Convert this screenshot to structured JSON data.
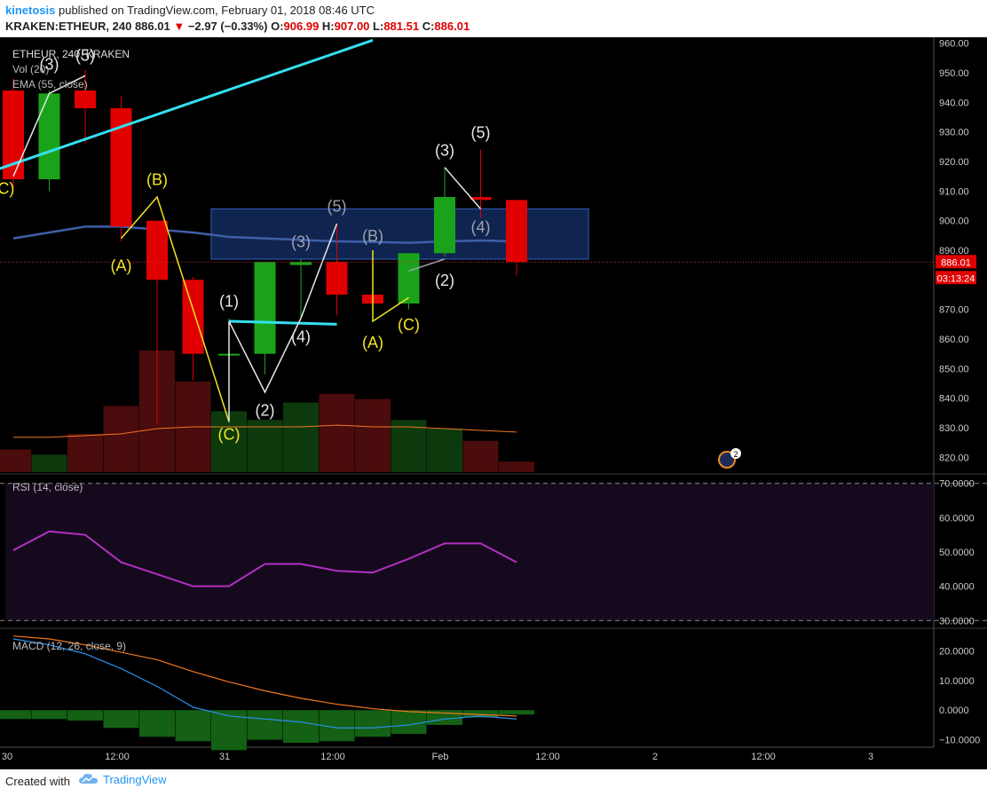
{
  "header": {
    "author": "kinetosis",
    "published": "published on TradingView.com, February 01, 2018 08:46 UTC",
    "symbol": "KRAKEN:ETHEUR, 240",
    "last": "886.01",
    "change": "−2.97 (−0.33%)",
    "o_label": "O:",
    "o": "906.99",
    "h_label": "H:",
    "h": "907.00",
    "l_label": "L:",
    "l": "881.51",
    "c_label": "C:",
    "c": "886.01"
  },
  "footer": {
    "created_with": "Created with",
    "brand": "TradingView"
  },
  "colors": {
    "up": "#1aa31a",
    "down": "#e00000",
    "background": "#000000",
    "ema": "#3f5fa8",
    "trendline": "#33e0f0",
    "wave_yellow": "#f5e51f",
    "wave_white": "#e6e6e6",
    "wave_grey": "#9aa2ab",
    "rsi": "#b12fbf",
    "macd": "#2b8fe8",
    "signal": "#f07820"
  },
  "chart_data": [
    {
      "type": "candlestick",
      "title": "ETHEUR, 240, KRAKEN",
      "indicators_legend": [
        "Vol (20)",
        "EMA (55, close)"
      ],
      "ylim": [
        815,
        962
      ],
      "y_ticks": [
        "960.00",
        "950.00",
        "940.00",
        "930.00",
        "920.00",
        "910.00",
        "900.00",
        "890.00",
        "880.00",
        "870.00",
        "860.00",
        "850.00",
        "840.00",
        "830.00",
        "820.00"
      ],
      "x_ticks": [
        "30",
        "12:00",
        "31",
        "12:00",
        "Feb",
        "12:00",
        "2",
        "12:00",
        "3"
      ],
      "last_price_label": "886.01",
      "countdown_label": "03:13:24",
      "candles": [
        {
          "o": 944,
          "h": 948,
          "l": 911,
          "c": 914
        },
        {
          "o": 914,
          "h": 944,
          "l": 910,
          "c": 943
        },
        {
          "o": 944,
          "h": 951,
          "l": 926,
          "c": 938
        },
        {
          "o": 938,
          "h": 942,
          "l": 893,
          "c": 898
        },
        {
          "o": 900,
          "h": 900,
          "l": 831,
          "c": 880
        },
        {
          "o": 880,
          "h": 881,
          "l": 846,
          "c": 855
        },
        {
          "o": 855,
          "h": 867,
          "l": 832,
          "c": 855
        },
        {
          "o": 855,
          "h": 886,
          "l": 848,
          "c": 886
        },
        {
          "o": 885,
          "h": 887,
          "l": 867,
          "c": 886
        },
        {
          "o": 886,
          "h": 899,
          "l": 868,
          "c": 875
        },
        {
          "o": 875,
          "h": 890,
          "l": 866,
          "c": 872
        },
        {
          "o": 872,
          "h": 889,
          "l": 870,
          "c": 889
        },
        {
          "o": 889,
          "h": 918,
          "l": 888,
          "c": 908
        },
        {
          "o": 908,
          "h": 924,
          "l": 901,
          "c": 907
        },
        {
          "o": 906.99,
          "h": 907,
          "l": 881.51,
          "c": 886.01
        }
      ],
      "volume": [
        13,
        10,
        22,
        38,
        70,
        52,
        35,
        30,
        40,
        45,
        42,
        30,
        25,
        18,
        6
      ],
      "ema": [
        894,
        896,
        898,
        898,
        897,
        896,
        894.5,
        894,
        893.5,
        893,
        892.8,
        892.5,
        893,
        893.3,
        893
      ],
      "vol_ma": [
        20,
        20,
        21,
        22,
        25,
        26,
        26,
        26,
        26,
        27,
        26,
        26,
        25,
        24,
        23
      ],
      "box": {
        "x0": 6,
        "x1": 16,
        "y0": 887,
        "y1": 904
      },
      "lines": [
        {
          "role": "trendline",
          "color": "trendline",
          "points": [
            [
              -1,
              915
            ],
            [
              10,
              961
            ]
          ]
        },
        {
          "role": "level",
          "color": "trendline",
          "points": [
            [
              6,
              866
            ],
            [
              9,
              865
            ]
          ]
        },
        {
          "role": "yellow-waves",
          "color": "wave_yellow",
          "points": [
            [
              3,
              894
            ],
            [
              4,
              908
            ],
            [
              6,
              832
            ]
          ]
        },
        {
          "role": "yellow-abc",
          "color": "wave_yellow",
          "points": [
            [
              10,
              890
            ],
            [
              10,
              866
            ],
            [
              11,
              874
            ]
          ]
        },
        {
          "role": "white-12345",
          "color": "wave_white",
          "points": [
            [
              6,
              832
            ],
            [
              6,
              866
            ],
            [
              7,
              842
            ],
            [
              8,
              867
            ],
            [
              9,
              899
            ]
          ]
        },
        {
          "role": "white-345",
          "color": "wave_white",
          "points": [
            [
              12,
              918
            ],
            [
              13,
              904
            ]
          ]
        },
        {
          "role": "grey-345",
          "color": "wave_grey",
          "points": [
            [
              11,
              883
            ],
            [
              12,
              887
            ]
          ]
        },
        {
          "role": "old-wave",
          "color": "wave_white",
          "points": [
            [
              0,
              915
            ],
            [
              1,
              943
            ],
            [
              2,
              949
            ]
          ]
        }
      ],
      "wave_labels": [
        {
          "text": "(5)",
          "i": 2,
          "v": 954,
          "color": "wave_white"
        },
        {
          "text": "(3)",
          "i": 1,
          "v": 951,
          "color": "wave_white"
        },
        {
          "text": "C)",
          "i": -0.2,
          "v": 909,
          "color": "wave_yellow"
        },
        {
          "text": "(A)",
          "i": 3,
          "v": 883,
          "color": "wave_yellow"
        },
        {
          "text": "(B)",
          "i": 4,
          "v": 912,
          "color": "wave_yellow"
        },
        {
          "text": "(1)",
          "i": 6,
          "v": 871,
          "color": "wave_white"
        },
        {
          "text": "(2)",
          "i": 7,
          "v": 834,
          "color": "wave_white"
        },
        {
          "text": "(C)",
          "i": 6,
          "v": 826,
          "color": "wave_yellow"
        },
        {
          "text": "(3)",
          "i": 8,
          "v": 891,
          "color": "wave_grey"
        },
        {
          "text": "(4)",
          "i": 8,
          "v": 859,
          "color": "wave_white"
        },
        {
          "text": "(5)",
          "i": 9,
          "v": 903,
          "color": "wave_grey"
        },
        {
          "text": "(B)",
          "i": 10,
          "v": 893,
          "color": "wave_grey"
        },
        {
          "text": "(A)",
          "i": 10,
          "v": 857,
          "color": "wave_yellow"
        },
        {
          "text": "(C)",
          "i": 11,
          "v": 863,
          "color": "wave_yellow"
        },
        {
          "text": "(3)",
          "i": 12,
          "v": 922,
          "color": "wave_white"
        },
        {
          "text": "(5)",
          "i": 13,
          "v": 928,
          "color": "wave_white"
        },
        {
          "text": "(2)",
          "i": 12,
          "v": 878,
          "color": "wave_white"
        },
        {
          "text": "(4)",
          "i": 13,
          "v": 896,
          "color": "wave_grey"
        }
      ],
      "event_badge": "2"
    },
    {
      "type": "line",
      "title": "RSI (14, close)",
      "ylim": [
        28,
        72
      ],
      "y_ticks": [
        "70.0000",
        "60.0000",
        "50.0000",
        "40.0000",
        "30.0000"
      ],
      "bands": [
        30,
        70
      ],
      "values": [
        50.5,
        56,
        55,
        47,
        43.5,
        40,
        40,
        46.5,
        46.5,
        44.5,
        44,
        48,
        52.5,
        52.5,
        47
      ]
    },
    {
      "type": "bar",
      "title": "MACD (12, 26, close, 9)",
      "ylim": [
        -12.5,
        27
      ],
      "y_ticks": [
        "20.0000",
        "10.0000",
        "0.0000",
        "−10.0000"
      ],
      "histogram": [
        -3,
        -3,
        -3.5,
        -6,
        -9,
        -10.5,
        -13.5,
        -10,
        -11,
        -10.5,
        -9,
        -8,
        -5,
        -2.5,
        -1.5
      ],
      "macd": [
        24,
        22,
        19,
        14,
        8,
        1,
        -2,
        -3,
        -4,
        -6,
        -6,
        -5,
        -3,
        -2,
        -3
      ],
      "signal": [
        25,
        24,
        22,
        19.5,
        17,
        13,
        9.5,
        6.5,
        4,
        2,
        0.5,
        -0.5,
        -1,
        -1.5,
        -2
      ]
    }
  ]
}
